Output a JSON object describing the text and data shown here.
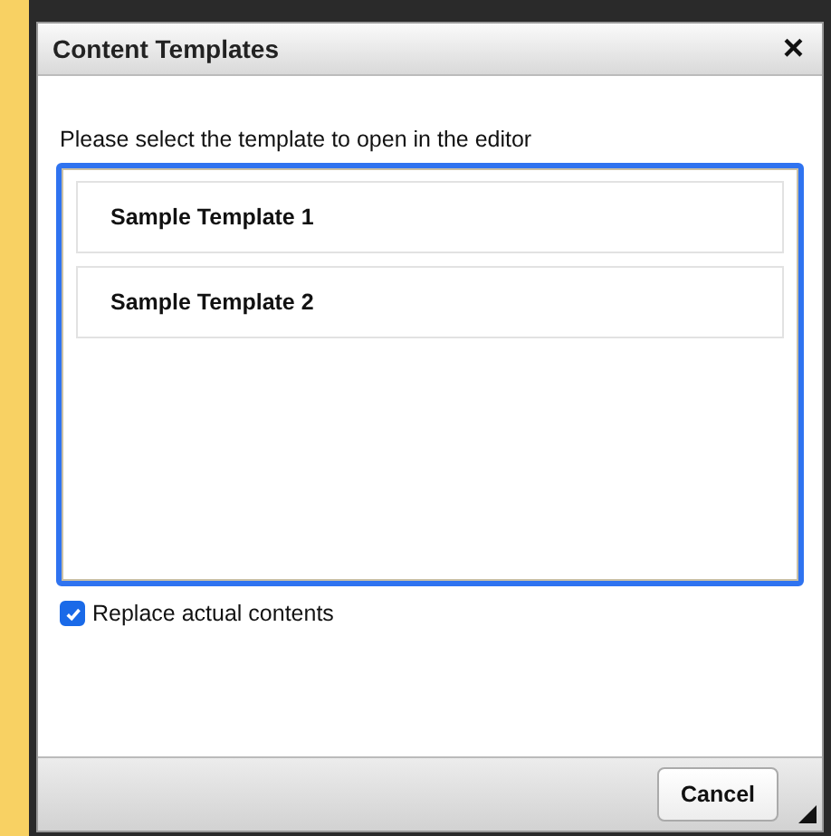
{
  "dialog": {
    "title": "Content Templates",
    "close": "×",
    "prompt": "Please select the template to open in the editor",
    "templates": [
      {
        "label": "Sample Template 1",
        "selected": false
      },
      {
        "label": "Sample Template 2",
        "selected": false
      }
    ],
    "replace": {
      "label": "Replace actual contents",
      "checked": true
    },
    "buttons": [
      "Cancel"
    ]
  }
}
